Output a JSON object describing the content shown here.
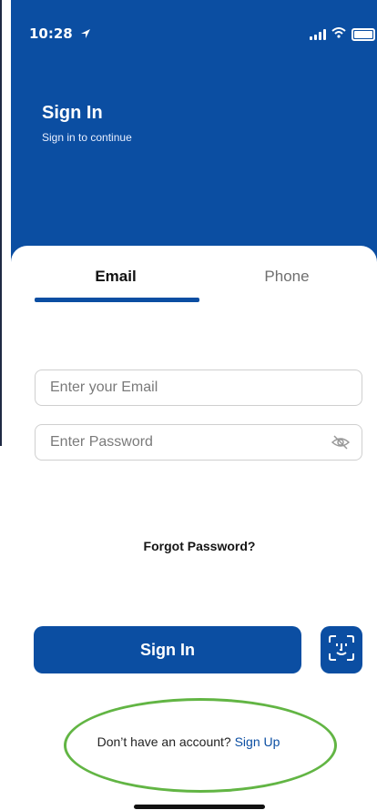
{
  "status_bar": {
    "time": "10:28"
  },
  "header": {
    "title": "Sign In",
    "subtitle": "Sign in to continue"
  },
  "tabs": [
    {
      "label": "Email",
      "active": true
    },
    {
      "label": "Phone",
      "active": false
    }
  ],
  "form": {
    "email_placeholder": "Enter your Email",
    "password_placeholder": "Enter Password",
    "forgot_password": "Forgot Password?"
  },
  "actions": {
    "sign_in": "Sign In"
  },
  "footer": {
    "prompt": "Don’t have an account?",
    "link": "Sign Up"
  },
  "colors": {
    "primary": "#0b4ea2",
    "highlight": "#62b544"
  },
  "icons": [
    "location-icon",
    "signal-icon",
    "wifi-icon",
    "battery-icon",
    "hide-password-icon",
    "face-id-icon"
  ]
}
